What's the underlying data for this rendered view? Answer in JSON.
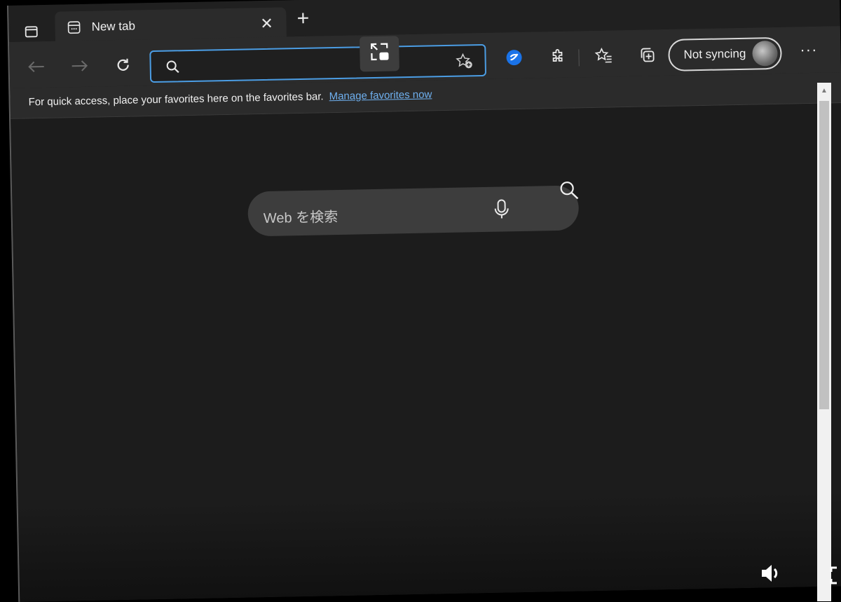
{
  "tabs": [
    {
      "title": "New tab"
    }
  ],
  "address_bar": {
    "value": ""
  },
  "profile": {
    "label": "Not syncing"
  },
  "favorites_bar": {
    "message": "For quick access, place your favorites here on the favorites bar.",
    "link": "Manage favorites now"
  },
  "web_search": {
    "placeholder": "Web を検索"
  },
  "toolbar": {
    "more_label": "···"
  },
  "colors": {
    "accent": "#4b9de4",
    "link": "#6fb0ef",
    "page_background": "#1c1c1c",
    "toolbar_background": "#2b2b2b"
  }
}
